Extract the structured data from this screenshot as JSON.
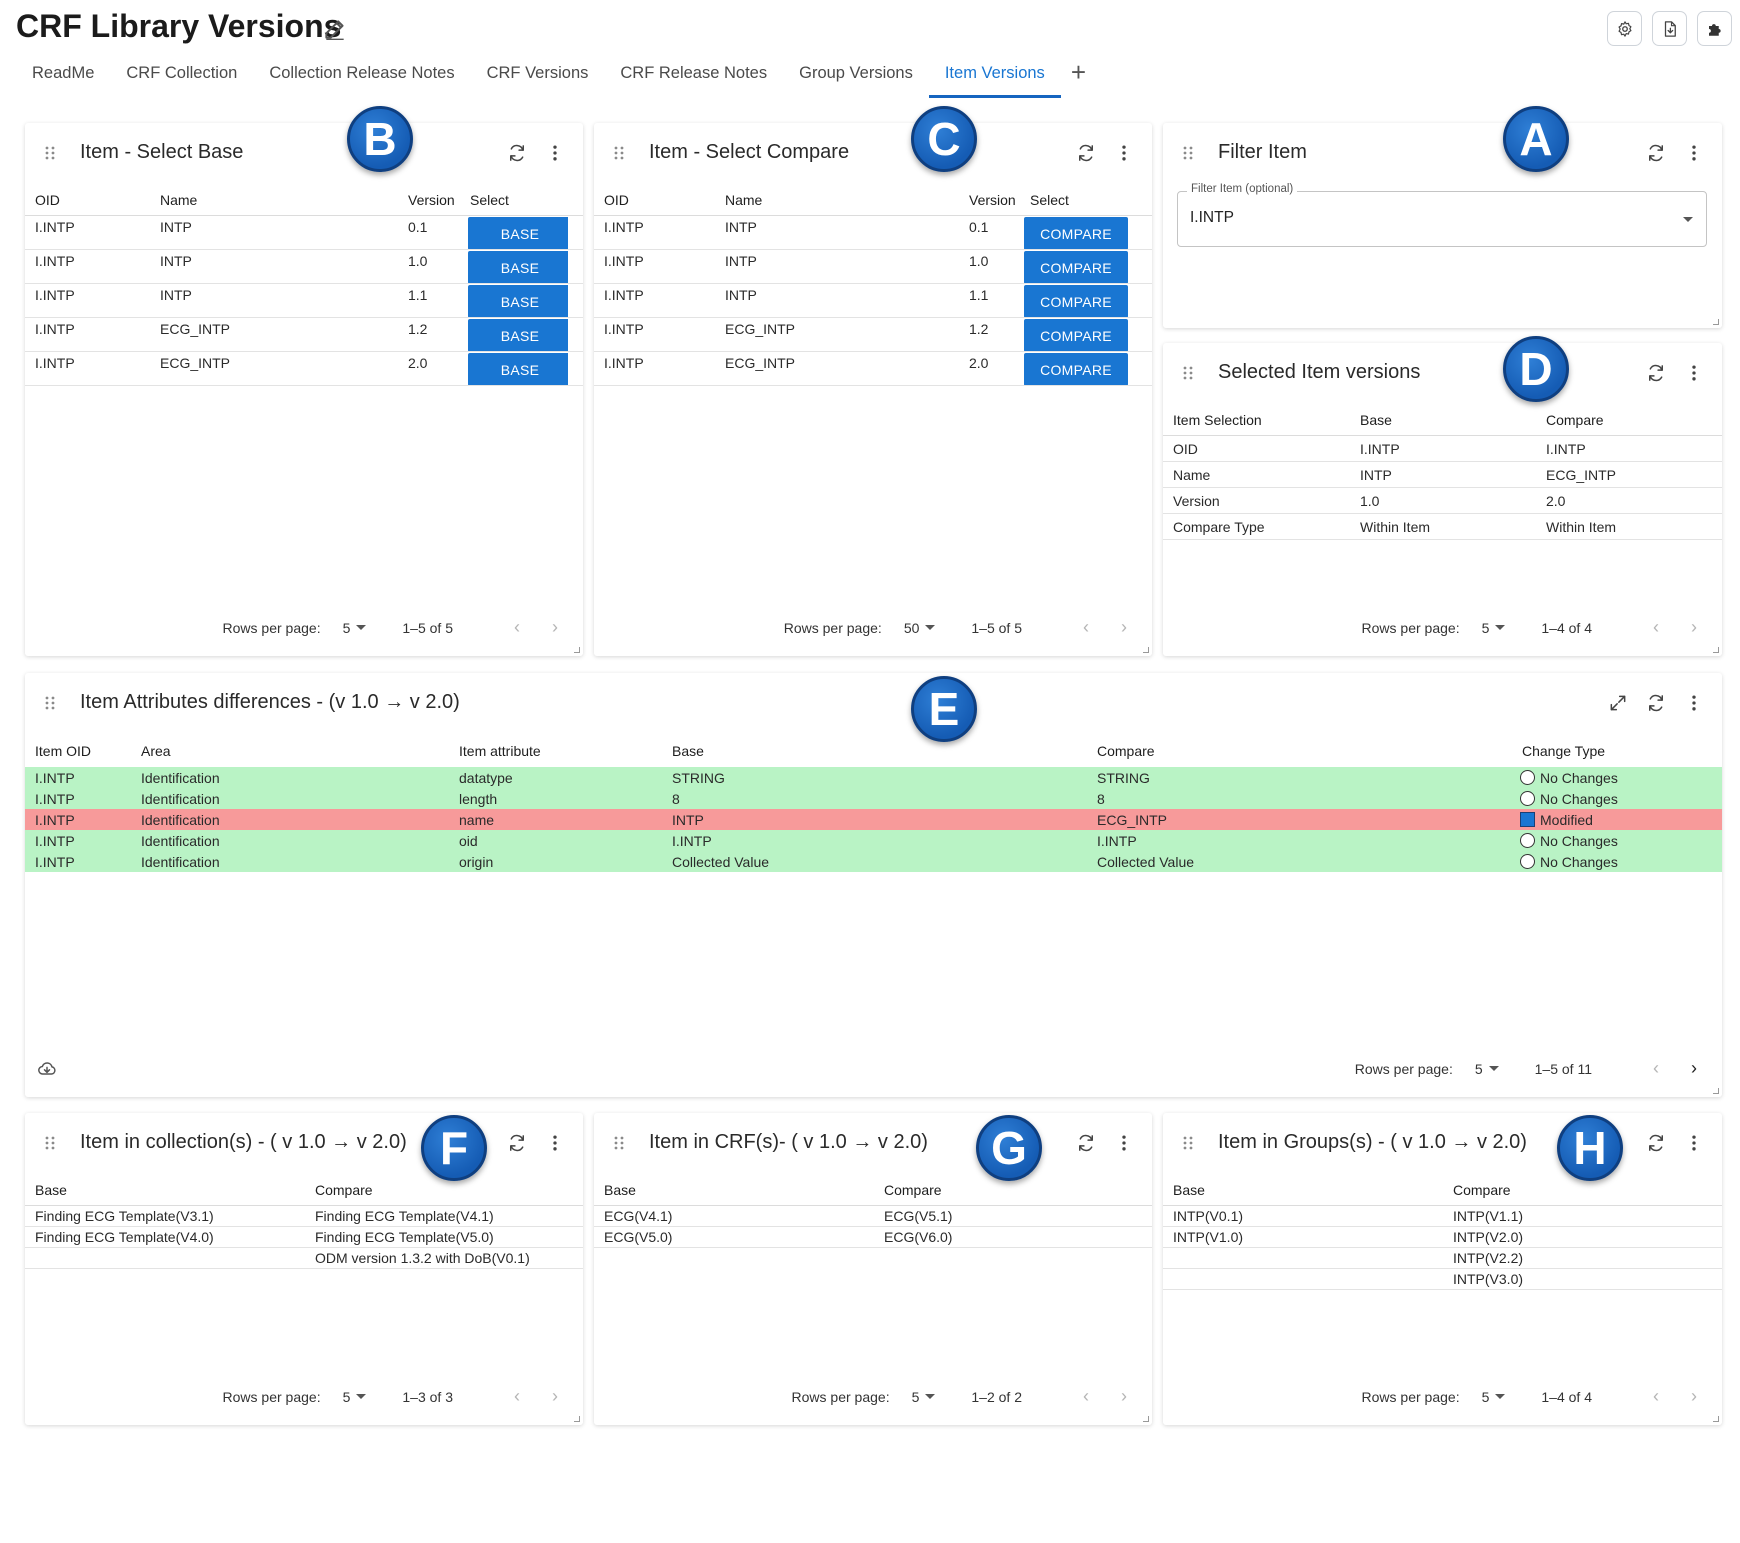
{
  "app": {
    "title": "CRF Library Versions",
    "tabs": [
      "ReadMe",
      "CRF Collection",
      "Collection Release Notes",
      "CRF Versions",
      "CRF Release Notes",
      "Group Versions",
      "Item Versions"
    ],
    "active_tab": "Item Versions",
    "add_tab_icon": "plus-icon",
    "top_icons": [
      "gear-icon",
      "file-download-icon",
      "puzzle-icon"
    ]
  },
  "pager": {
    "rows_per_page": "Rows per page:"
  },
  "badges": {
    "a": "A",
    "b": "B",
    "c": "C",
    "d": "D",
    "e": "E",
    "f": "F",
    "g": "G",
    "h": "H"
  },
  "select_base": {
    "title": "Item - Select Base",
    "columns": [
      "OID",
      "Name",
      "Version",
      "Select"
    ],
    "rows": [
      {
        "oid": "I.INTP",
        "name": "INTP",
        "version": "0.1",
        "button": "BASE"
      },
      {
        "oid": "I.INTP",
        "name": "INTP",
        "version": "1.0",
        "button": "BASE"
      },
      {
        "oid": "I.INTP",
        "name": "INTP",
        "version": "1.1",
        "button": "BASE"
      },
      {
        "oid": "I.INTP",
        "name": "ECG_INTP",
        "version": "1.2",
        "button": "BASE"
      },
      {
        "oid": "I.INTP",
        "name": "ECG_INTP",
        "version": "2.0",
        "button": "BASE"
      }
    ],
    "rows_value": "5",
    "count": "1–5 of 5"
  },
  "select_compare": {
    "title": "Item - Select Compare",
    "columns": [
      "OID",
      "Name",
      "Version",
      "Select"
    ],
    "rows": [
      {
        "oid": "I.INTP",
        "name": "INTP",
        "version": "0.1",
        "button": "COMPARE"
      },
      {
        "oid": "I.INTP",
        "name": "INTP",
        "version": "1.0",
        "button": "COMPARE"
      },
      {
        "oid": "I.INTP",
        "name": "INTP",
        "version": "1.1",
        "button": "COMPARE"
      },
      {
        "oid": "I.INTP",
        "name": "ECG_INTP",
        "version": "1.2",
        "button": "COMPARE"
      },
      {
        "oid": "I.INTP",
        "name": "ECG_INTP",
        "version": "2.0",
        "button": "COMPARE"
      }
    ],
    "rows_value": "50",
    "count": "1–5 of 5"
  },
  "filter": {
    "title": "Filter Item",
    "label": "Filter Item (optional)",
    "value": "I.INTP"
  },
  "selected": {
    "title": "Selected Item versions",
    "columns": [
      "Item Selection",
      "Base",
      "Compare"
    ],
    "rows": [
      {
        "k": "OID",
        "base": "I.INTP",
        "compare": "I.INTP"
      },
      {
        "k": "Name",
        "base": "INTP",
        "compare": "ECG_INTP"
      },
      {
        "k": "Version",
        "base": "1.0",
        "compare": "2.0"
      },
      {
        "k": "Compare Type",
        "base": "Within Item",
        "compare": "Within Item"
      }
    ],
    "rows_value": "5",
    "count": "1–4 of 4"
  },
  "diff": {
    "title": "Item Attributes differences - (v 1.0 → v 2.0)",
    "columns": [
      "Item OID",
      "Area",
      "Item attribute",
      "Base",
      "Compare",
      "Change Type"
    ],
    "rows": [
      {
        "oid": "I.INTP",
        "area": "Identification",
        "attr": "datatype",
        "base": "STRING",
        "compare": "STRING",
        "change": "No Changes",
        "status": "same"
      },
      {
        "oid": "I.INTP",
        "area": "Identification",
        "attr": "length",
        "base": "8",
        "compare": "8",
        "change": "No Changes",
        "status": "same"
      },
      {
        "oid": "I.INTP",
        "area": "Identification",
        "attr": "name",
        "base": "INTP",
        "compare": "ECG_INTP",
        "change": "Modified",
        "status": "modified"
      },
      {
        "oid": "I.INTP",
        "area": "Identification",
        "attr": "oid",
        "base": "I.INTP",
        "compare": "I.INTP",
        "change": "No Changes",
        "status": "same"
      },
      {
        "oid": "I.INTP",
        "area": "Identification",
        "attr": "origin",
        "base": "Collected Value",
        "compare": "Collected Value",
        "change": "No Changes",
        "status": "same"
      }
    ],
    "colors": {
      "same": "#b9f3c5",
      "modified": "#f79a9a"
    },
    "rows_value": "5",
    "count": "1–5 of 11"
  },
  "collections": {
    "title": "Item in collection(s) - ( v 1.0 → v 2.0)",
    "columns": [
      "Base",
      "Compare"
    ],
    "rows": [
      {
        "base": "Finding ECG Template(V3.1)",
        "compare": "Finding ECG Template(V4.1)"
      },
      {
        "base": "Finding ECG Template(V4.0)",
        "compare": "Finding ECG Template(V5.0)"
      },
      {
        "base": "",
        "compare": "ODM version 1.3.2 with DoB(V0.1)"
      }
    ],
    "rows_value": "5",
    "count": "1–3 of 3"
  },
  "crfs": {
    "title": "Item in CRF(s)-  ( v 1.0 → v 2.0)",
    "columns": [
      "Base",
      "Compare"
    ],
    "rows": [
      {
        "base": "ECG(V4.1)",
        "compare": "ECG(V5.1)"
      },
      {
        "base": "ECG(V5.0)",
        "compare": "ECG(V6.0)"
      }
    ],
    "rows_value": "5",
    "count": "1–2 of 2"
  },
  "groups": {
    "title": "Item in Groups(s) - ( v 1.0 → v 2.0)",
    "columns": [
      "Base",
      "Compare"
    ],
    "rows": [
      {
        "base": "INTP(V0.1)",
        "compare": "INTP(V1.1)"
      },
      {
        "base": "INTP(V1.0)",
        "compare": "INTP(V2.0)"
      },
      {
        "base": "",
        "compare": "INTP(V2.2)"
      },
      {
        "base": "",
        "compare": "INTP(V3.0)"
      }
    ],
    "rows_value": "5",
    "count": "1–4 of 4"
  }
}
